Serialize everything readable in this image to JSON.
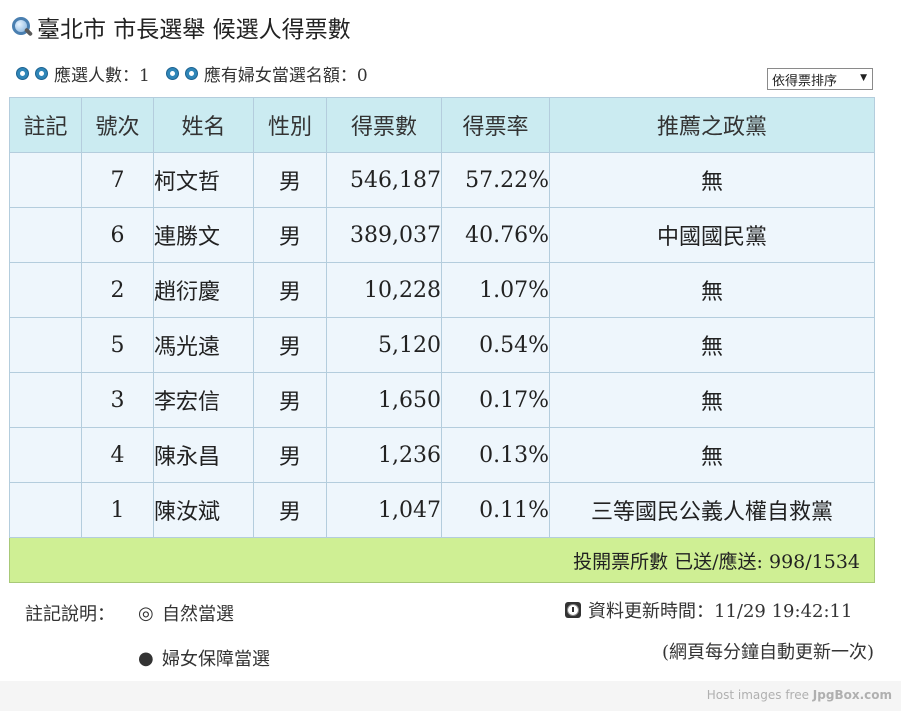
{
  "title": "臺北市 市長選舉 候選人得票數",
  "meta": {
    "seats": "應選人數：1",
    "women_seats": "應有婦女當選名額：0"
  },
  "sort_select": {
    "value": "依得票排序"
  },
  "table": {
    "headers": [
      "註記",
      "號次",
      "姓名",
      "性別",
      "得票數",
      "得票率",
      "推薦之政黨"
    ],
    "rows": [
      {
        "note": "",
        "number": "7",
        "name": "柯文哲",
        "gender": "男",
        "votes": "546,187",
        "rate": "57.22%",
        "party": "無"
      },
      {
        "note": "",
        "number": "6",
        "name": "連勝文",
        "gender": "男",
        "votes": "389,037",
        "rate": "40.76%",
        "party": "中國國民黨"
      },
      {
        "note": "",
        "number": "2",
        "name": "趙衍慶",
        "gender": "男",
        "votes": "10,228",
        "rate": "1.07%",
        "party": "無"
      },
      {
        "note": "",
        "number": "5",
        "name": "馮光遠",
        "gender": "男",
        "votes": "5,120",
        "rate": "0.54%",
        "party": "無"
      },
      {
        "note": "",
        "number": "3",
        "name": "李宏信",
        "gender": "男",
        "votes": "1,650",
        "rate": "0.17%",
        "party": "無"
      },
      {
        "note": "",
        "number": "4",
        "name": "陳永昌",
        "gender": "男",
        "votes": "1,236",
        "rate": "0.13%",
        "party": "無"
      },
      {
        "note": "",
        "number": "1",
        "name": "陳汝斌",
        "gender": "男",
        "votes": "1,047",
        "rate": "0.11%",
        "party": "三等國民公義人權自救黨"
      }
    ],
    "footer": "投開票所數 已送/應送: 998/1534"
  },
  "legend": {
    "label": "註記說明：",
    "items": [
      {
        "symbol": "◎",
        "text": "自然當選"
      },
      {
        "symbol": "●",
        "text": "婦女保障當選"
      }
    ]
  },
  "update": {
    "text": "資料更新時間：11/29 19:42:11",
    "auto_note": "(網頁每分鐘自動更新一次)"
  },
  "host": {
    "prefix": "Host images free ",
    "brand": "JpgBox.com"
  },
  "colors": {
    "header_bg": "#cbebf1",
    "row_bg": "#eef6fc",
    "footer_bg": "#cfef94",
    "bullet": "#2f86b8"
  }
}
